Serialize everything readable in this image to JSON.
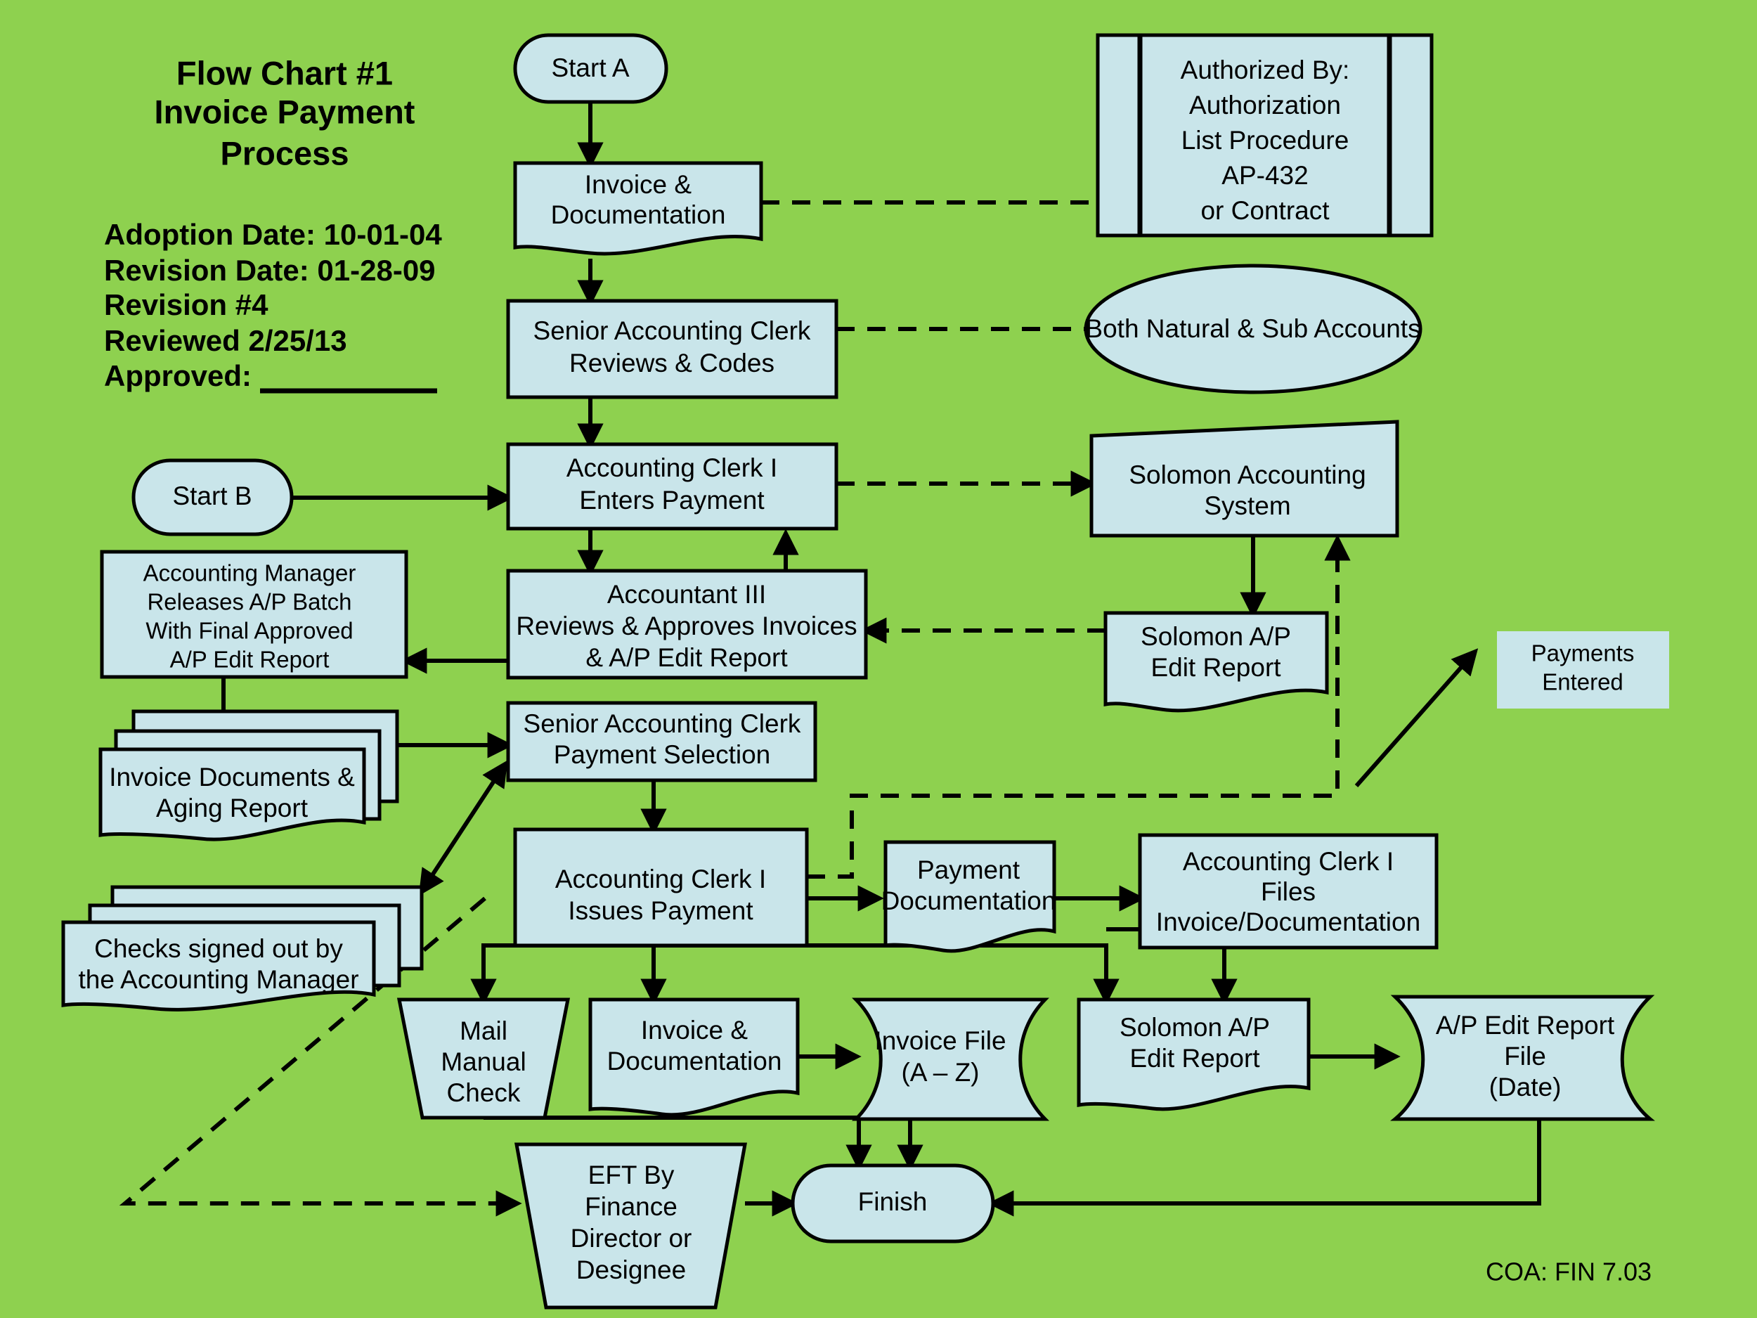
{
  "header": {
    "title_lines": [
      "Flow Chart #1",
      "Invoice Payment",
      "Process"
    ],
    "meta_lines": [
      "Adoption Date: 10-01-04",
      "Revision Date:  01-28-09",
      "Revision #4",
      "Reviewed 2/25/13",
      "Approved:"
    ]
  },
  "footer": {
    "coa": "COA: FIN 7.03"
  },
  "colors": {
    "background": "#8ed14f",
    "shape_fill": "#c9e5ea",
    "stroke": "#000000"
  },
  "chart_data": {
    "type": "diagram",
    "title": "Flow Chart #1 Invoice Payment Process",
    "nodes": [
      {
        "id": "start_a",
        "shape": "terminator",
        "lines": [
          "Start A"
        ]
      },
      {
        "id": "invoice_doc_top",
        "shape": "document",
        "lines": [
          "Invoice &",
          "Documentation"
        ]
      },
      {
        "id": "authorized_by",
        "shape": "predefined-process",
        "lines": [
          "Authorized By:",
          "Authorization",
          "List Procedure",
          "AP-432",
          "or Contract"
        ]
      },
      {
        "id": "sr_clerk_reviews",
        "shape": "process",
        "lines": [
          "Senior Accounting Clerk",
          "Reviews & Codes"
        ]
      },
      {
        "id": "both_accounts",
        "shape": "ellipse",
        "lines": [
          "Both Natural & Sub Accounts"
        ]
      },
      {
        "id": "start_b",
        "shape": "terminator",
        "lines": [
          "Start B"
        ]
      },
      {
        "id": "clerk_enters",
        "shape": "process",
        "lines": [
          "Accounting Clerk I",
          "Enters Payment"
        ]
      },
      {
        "id": "solomon_system",
        "shape": "data-slanted",
        "lines": [
          "Solomon Accounting",
          "System"
        ]
      },
      {
        "id": "acct_mgr_releases",
        "shape": "process",
        "lines": [
          "Accounting Manager",
          "Releases A/P Batch",
          "With Final Approved",
          "A/P Edit Report"
        ]
      },
      {
        "id": "accountant_iii",
        "shape": "process",
        "lines": [
          "Accountant III",
          "Reviews & Approves Invoices",
          "& A/P Edit Report"
        ]
      },
      {
        "id": "solomon_ap_edit_1",
        "shape": "document",
        "lines": [
          "Solomon A/P",
          "Edit Report"
        ]
      },
      {
        "id": "payments_entered",
        "shape": "box-nofill-border",
        "lines": [
          "Payments",
          "Entered"
        ]
      },
      {
        "id": "invoice_docs_aging",
        "shape": "multi-document",
        "lines": [
          "Invoice Documents &",
          "Aging Report"
        ]
      },
      {
        "id": "sr_clerk_selection",
        "shape": "process",
        "lines": [
          "Senior Accounting Clerk",
          "Payment Selection"
        ]
      },
      {
        "id": "checks_signed",
        "shape": "multi-document",
        "lines": [
          "Checks signed out by",
          "the Accounting Manager"
        ]
      },
      {
        "id": "clerk_issues",
        "shape": "process",
        "lines": [
          "Accounting Clerk I",
          "Issues Payment"
        ]
      },
      {
        "id": "payment_doc",
        "shape": "document",
        "lines": [
          "Payment",
          "Documentation"
        ]
      },
      {
        "id": "clerk_files",
        "shape": "process",
        "lines": [
          "Accounting Clerk I",
          "Files",
          "Invoice/Documentation"
        ]
      },
      {
        "id": "mail_manual_check",
        "shape": "trapezoid",
        "lines": [
          "Mail",
          "Manual",
          "Check"
        ]
      },
      {
        "id": "invoice_doc_bottom",
        "shape": "document",
        "lines": [
          "Invoice &",
          "Documentation"
        ]
      },
      {
        "id": "invoice_file",
        "shape": "stored-data",
        "lines": [
          "Invoice File",
          "(A – Z)"
        ]
      },
      {
        "id": "solomon_ap_edit_2",
        "shape": "document",
        "lines": [
          "Solomon A/P",
          "Edit Report"
        ]
      },
      {
        "id": "ap_edit_report_file",
        "shape": "stored-data",
        "lines": [
          "A/P Edit Report",
          "File",
          "(Date)"
        ]
      },
      {
        "id": "eft_finance",
        "shape": "trapezoid",
        "lines": [
          "EFT By",
          "Finance",
          "Director or",
          "Designee"
        ]
      },
      {
        "id": "finish",
        "shape": "terminator",
        "lines": [
          "Finish"
        ]
      }
    ],
    "edges": [
      {
        "from": "start_a",
        "to": "invoice_doc_top",
        "style": "solid"
      },
      {
        "from": "invoice_doc_top",
        "to": "authorized_by",
        "style": "dashed"
      },
      {
        "from": "invoice_doc_top",
        "to": "sr_clerk_reviews",
        "style": "solid"
      },
      {
        "from": "sr_clerk_reviews",
        "to": "both_accounts",
        "style": "dashed"
      },
      {
        "from": "sr_clerk_reviews",
        "to": "clerk_enters",
        "style": "solid"
      },
      {
        "from": "start_b",
        "to": "clerk_enters",
        "style": "solid"
      },
      {
        "from": "clerk_enters",
        "to": "solomon_system",
        "style": "dashed"
      },
      {
        "from": "clerk_enters",
        "to": "accountant_iii",
        "style": "solid"
      },
      {
        "from": "solomon_system",
        "to": "solomon_ap_edit_1",
        "style": "solid"
      },
      {
        "from": "solomon_ap_edit_1",
        "to": "accountant_iii",
        "style": "dashed"
      },
      {
        "from": "accountant_iii",
        "to": "clerk_enters",
        "style": "solid"
      },
      {
        "from": "accountant_iii",
        "to": "acct_mgr_releases",
        "style": "solid"
      },
      {
        "from": "acct_mgr_releases",
        "to": "invoice_docs_aging",
        "style": "solid"
      },
      {
        "from": "invoice_docs_aging",
        "to": "sr_clerk_selection",
        "style": "solid"
      },
      {
        "from": "checks_signed",
        "to": "sr_clerk_selection",
        "style": "solid-bidirectional"
      },
      {
        "from": "sr_clerk_selection",
        "to": "clerk_issues",
        "style": "solid"
      },
      {
        "from": "clerk_issues",
        "to": "payment_doc",
        "style": "solid"
      },
      {
        "from": "clerk_issues",
        "to": "solomon_system",
        "style": "dashed"
      },
      {
        "from": "clerk_issues",
        "to": "eft_finance",
        "style": "dashed"
      },
      {
        "from": "clerk_issues",
        "to": "mail_manual_check",
        "style": "solid"
      },
      {
        "from": "clerk_issues",
        "to": "invoice_doc_bottom",
        "style": "solid"
      },
      {
        "from": "payment_doc",
        "to": "clerk_files",
        "style": "solid"
      },
      {
        "from": "payment_doc",
        "to": "solomon_ap_edit_2",
        "style": "solid"
      },
      {
        "from": "clerk_files",
        "to": "solomon_ap_edit_2",
        "style": "solid"
      },
      {
        "from": "solomon_ap_edit_2",
        "to": "ap_edit_report_file",
        "style": "solid"
      },
      {
        "from": "invoice_doc_bottom",
        "to": "invoice_file",
        "style": "solid"
      },
      {
        "from": "invoice_file",
        "to": "finish",
        "style": "solid"
      },
      {
        "from": "mail_manual_check",
        "to": "finish",
        "style": "solid"
      },
      {
        "from": "eft_finance",
        "to": "finish",
        "style": "solid"
      },
      {
        "from": "ap_edit_report_file",
        "to": "finish",
        "style": "solid"
      },
      {
        "from": "payments_entered",
        "to": null,
        "style": "solid-incoming-from-dashed-junction"
      }
    ]
  }
}
